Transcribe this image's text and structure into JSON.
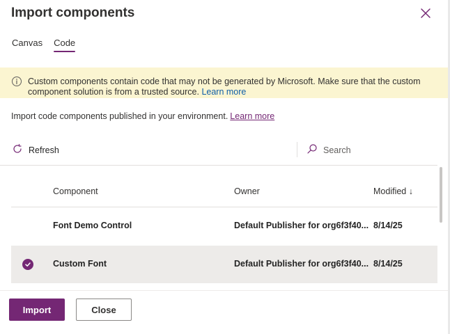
{
  "dialog": {
    "title": "Import components",
    "close_icon": "close-icon"
  },
  "tabs": [
    {
      "label": "Canvas",
      "active": false
    },
    {
      "label": "Code",
      "active": true
    }
  ],
  "banner": {
    "icon": "info-icon",
    "message": "Custom components contain code that may not be generated by Microsoft. Make sure that the custom component solution is from a trusted source.",
    "link": "Learn more"
  },
  "description": {
    "text": "Import code components published in your environment.",
    "link": "Learn more"
  },
  "toolbar": {
    "refresh_label": "Refresh",
    "search_placeholder": "Search"
  },
  "table": {
    "columns": {
      "component": "Component",
      "owner": "Owner",
      "modified": "Modified ↓"
    },
    "rows": [
      {
        "component": "Font Demo Control",
        "owner": "Default Publisher for org6f3f40...",
        "modified": "8/14/25",
        "selected": false
      },
      {
        "component": "Custom Font",
        "owner": "Default Publisher for org6f3f40...",
        "modified": "8/14/25",
        "selected": true
      }
    ]
  },
  "footer": {
    "import_label": "Import",
    "close_label": "Close"
  },
  "colors": {
    "accent": "#742774",
    "banner_bg": "#fbf5d1",
    "selected_row_bg": "#edebe9"
  }
}
